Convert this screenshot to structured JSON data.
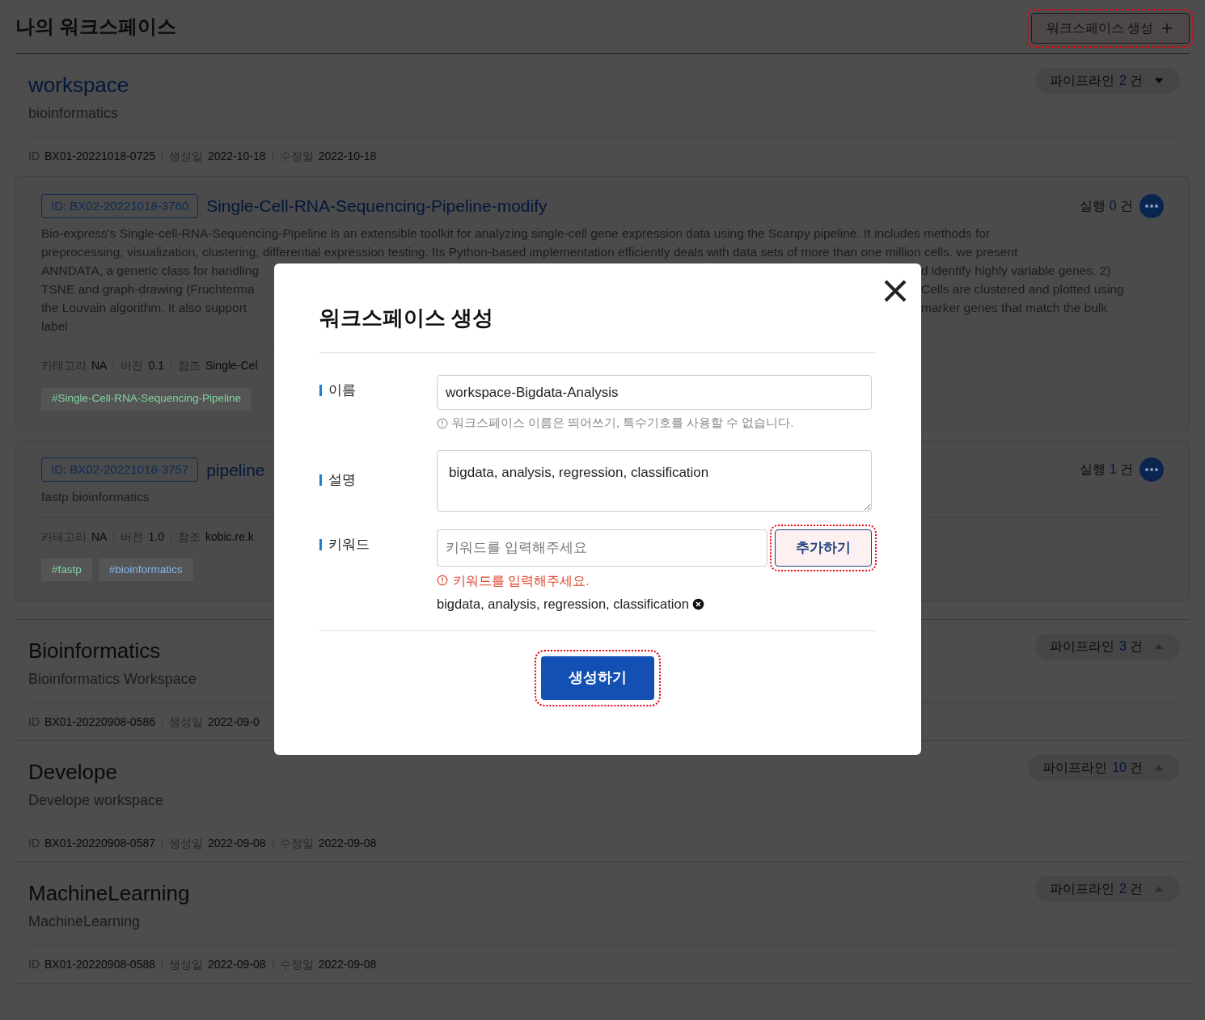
{
  "page": {
    "title": "나의 워크스페이스",
    "create_button": "워크스페이스 생성"
  },
  "workspaces": [
    {
      "name": "workspace",
      "description": "bioinformatics",
      "expanded": true,
      "count_label": "파이프라인",
      "count": "2",
      "count_unit": "건",
      "meta": [
        {
          "label": "ID",
          "value": "BX01-20221018-0725"
        },
        {
          "label": "생성일",
          "value": "2022-10-18"
        },
        {
          "label": "수정일",
          "value": "2022-10-18"
        }
      ],
      "pipelines": [
        {
          "id_badge": "ID: BX02-20221018-3760",
          "name": "Single-Cell-RNA-Sequencing-Pipeline-modify",
          "run_label": "실행",
          "run_count": "0",
          "run_unit": "건",
          "description_lines": [
            [
              "Bio-express's Single-cell-RNA-Sequencing-Pipeline is an extensible toolkit for analyzing single-cell gene expression data using the Scanpy pipeline. It includes methods for"
            ],
            [
              "preprocessing, visualization, clustering, differential expression testing. Its Python-based implementation efficiently deals with data sets of more than one million cells. we present"
            ],
            [
              "ANNDATA, a generic class for handling",
              "d identify highly variable genes. 2)"
            ],
            [
              "TSNE and graph-drawing (Fruchterma",
              "Cells are clustered and plotted using"
            ],
            [
              "the Louvain algorithm. It also support",
              "marker genes that match the bulk"
            ],
            [
              "label"
            ]
          ],
          "meta": [
            {
              "label": "카테고리",
              "value": "NA"
            },
            {
              "label": "버전",
              "value": "0.1"
            },
            {
              "label": "참조",
              "value": "Single-Cel"
            }
          ],
          "tags": [
            {
              "text": "#Single-Cell-RNA-Sequencing-Pipeline",
              "color": "#7fd6a0"
            }
          ]
        },
        {
          "id_badge": "ID: BX02-20221018-3757",
          "name": "pipeline",
          "run_label": "실행",
          "run_count": "1",
          "run_unit": "건",
          "description_lines": [
            [
              "fastp bioinformatics"
            ]
          ],
          "meta": [
            {
              "label": "카테고리",
              "value": "NA"
            },
            {
              "label": "버전",
              "value": "1.0"
            },
            {
              "label": "참조",
              "value": "kobic.re.k"
            }
          ],
          "tags": [
            {
              "text": "#fastp",
              "color": "#7fd6a0"
            },
            {
              "text": "#bioinformatics",
              "color": "#86b4ea"
            }
          ]
        }
      ]
    },
    {
      "name": "Bioinformatics",
      "description": "Bioinformatics Workspace",
      "expanded": false,
      "count_label": "파이프라인",
      "count": "3",
      "count_unit": "건",
      "meta": [
        {
          "label": "ID",
          "value": "BX01-20220908-0586"
        },
        {
          "label": "생성일",
          "value": "2022-09-0"
        }
      ]
    },
    {
      "name": "Develope",
      "description": "Develope workspace",
      "expanded": false,
      "count_label": "파이프라인",
      "count": "10",
      "count_unit": "건",
      "meta": [
        {
          "label": "ID",
          "value": "BX01-20220908-0587"
        },
        {
          "label": "생성일",
          "value": "2022-09-08"
        },
        {
          "label": "수정일",
          "value": "2022-09-08"
        }
      ]
    },
    {
      "name": "MachineLearning",
      "description": "MachineLearning",
      "expanded": false,
      "count_label": "파이프라인",
      "count": "2",
      "count_unit": "건",
      "meta": [
        {
          "label": "ID",
          "value": "BX01-20220908-0588"
        },
        {
          "label": "생성일",
          "value": "2022-09-08"
        },
        {
          "label": "수정일",
          "value": "2022-09-08"
        }
      ]
    }
  ],
  "modal": {
    "title": "워크스페이스 생성",
    "fields": [
      {
        "kind": "text",
        "label": "이름",
        "value": "workspace-Bigdata-Analysis",
        "hint": "워크스페이스 이름은 띄어쓰기, 특수기호를 사용할 수 없습니다."
      },
      {
        "kind": "textarea",
        "label": "설명",
        "value": "bigdata, analysis, regression, classification"
      },
      {
        "kind": "keyword",
        "label": "키워드",
        "placeholder": "키워드를 입력해주세요",
        "button": "추가하기",
        "error": "키워드를 입력해주세요.",
        "keywords": [
          "bigdata, analysis, regression, classification"
        ]
      }
    ],
    "submit": "생성하기"
  }
}
